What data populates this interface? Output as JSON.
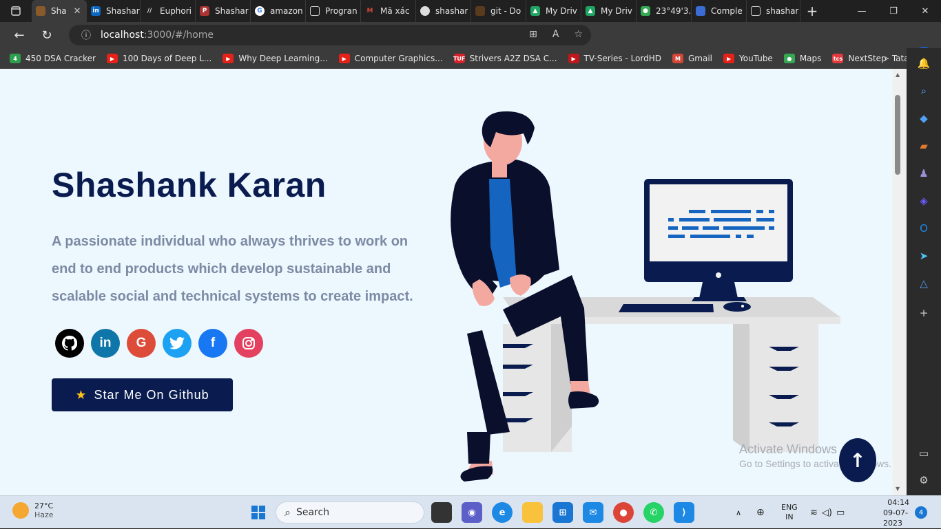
{
  "browser": {
    "tabs": [
      {
        "label": "Sha",
        "active": true
      },
      {
        "label": "Shashar",
        "icon": "linkedin-icon"
      },
      {
        "label": "Euphori",
        "icon": "chevrons-icon"
      },
      {
        "label": "Shashar",
        "icon": "pdf-icon"
      },
      {
        "label": "amazon",
        "icon": "google-icon"
      },
      {
        "label": "Progran",
        "icon": "page-icon"
      },
      {
        "label": "Mã xác",
        "icon": "gmail-icon"
      },
      {
        "label": "shashar",
        "icon": "github-icon"
      },
      {
        "label": "git - Do",
        "icon": "git-icon"
      },
      {
        "label": "My Driv",
        "icon": "drive-icon"
      },
      {
        "label": "My Driv",
        "icon": "drive-icon"
      },
      {
        "label": "23°49'3.",
        "icon": "maps-icon"
      },
      {
        "label": "Comple",
        "icon": "docs-icon"
      },
      {
        "label": "shashar",
        "icon": "page-icon"
      }
    ],
    "url_host": "localhost",
    "url_rest": ":3000/#/home",
    "favorites": [
      {
        "label": "450 DSA Cracker",
        "color": "#2e9e4f",
        "glyph": "4"
      },
      {
        "label": "100 Days of Deep L...",
        "color": "#e62117",
        "glyph": "▶"
      },
      {
        "label": "Why Deep Learning...",
        "color": "#e62117",
        "glyph": "▶"
      },
      {
        "label": "Computer Graphics...",
        "color": "#e62117",
        "glyph": "▶"
      },
      {
        "label": "Strivers A2Z DSA C...",
        "color": "#d6222a",
        "glyph": "TUF"
      },
      {
        "label": "TV-Series - LordHD",
        "color": "#c2161a",
        "glyph": "▶"
      },
      {
        "label": "Gmail",
        "color": "#d44638",
        "glyph": "M"
      },
      {
        "label": "YouTube",
        "color": "#e62117",
        "glyph": "▶"
      },
      {
        "label": "Maps",
        "color": "#34a853",
        "glyph": "●"
      },
      {
        "label": "NextStep- Tata Con...",
        "color": "#e03a3e",
        "glyph": "tcs"
      }
    ]
  },
  "hero": {
    "name": "Shashank Karan",
    "subtitle": "A passionate individual who always thrives to work on end to end products which develop sustainable and scalable social and technical systems to create impact.",
    "cta": "Star Me On Github",
    "socials": [
      {
        "name": "github",
        "glyph": "",
        "color": "#000000"
      },
      {
        "name": "linkedin",
        "glyph": "in",
        "color": "#0e76a8"
      },
      {
        "name": "google",
        "glyph": "G",
        "color": "#dd4b39"
      },
      {
        "name": "twitter",
        "glyph": "",
        "color": "#1da1f2"
      },
      {
        "name": "facebook",
        "glyph": "f",
        "color": "#1877f2"
      },
      {
        "name": "instagram",
        "glyph": "",
        "color": "#e4405f"
      }
    ]
  },
  "watermark": {
    "line1": "Activate Windows",
    "line2": "Go to Settings to activate Windows."
  },
  "taskbar": {
    "temp": "27°C",
    "weather": "Haze",
    "search": "Search",
    "lang1": "ENG",
    "lang2": "IN",
    "time": "04:14",
    "date": "09-07-2023",
    "notifications": "4"
  }
}
